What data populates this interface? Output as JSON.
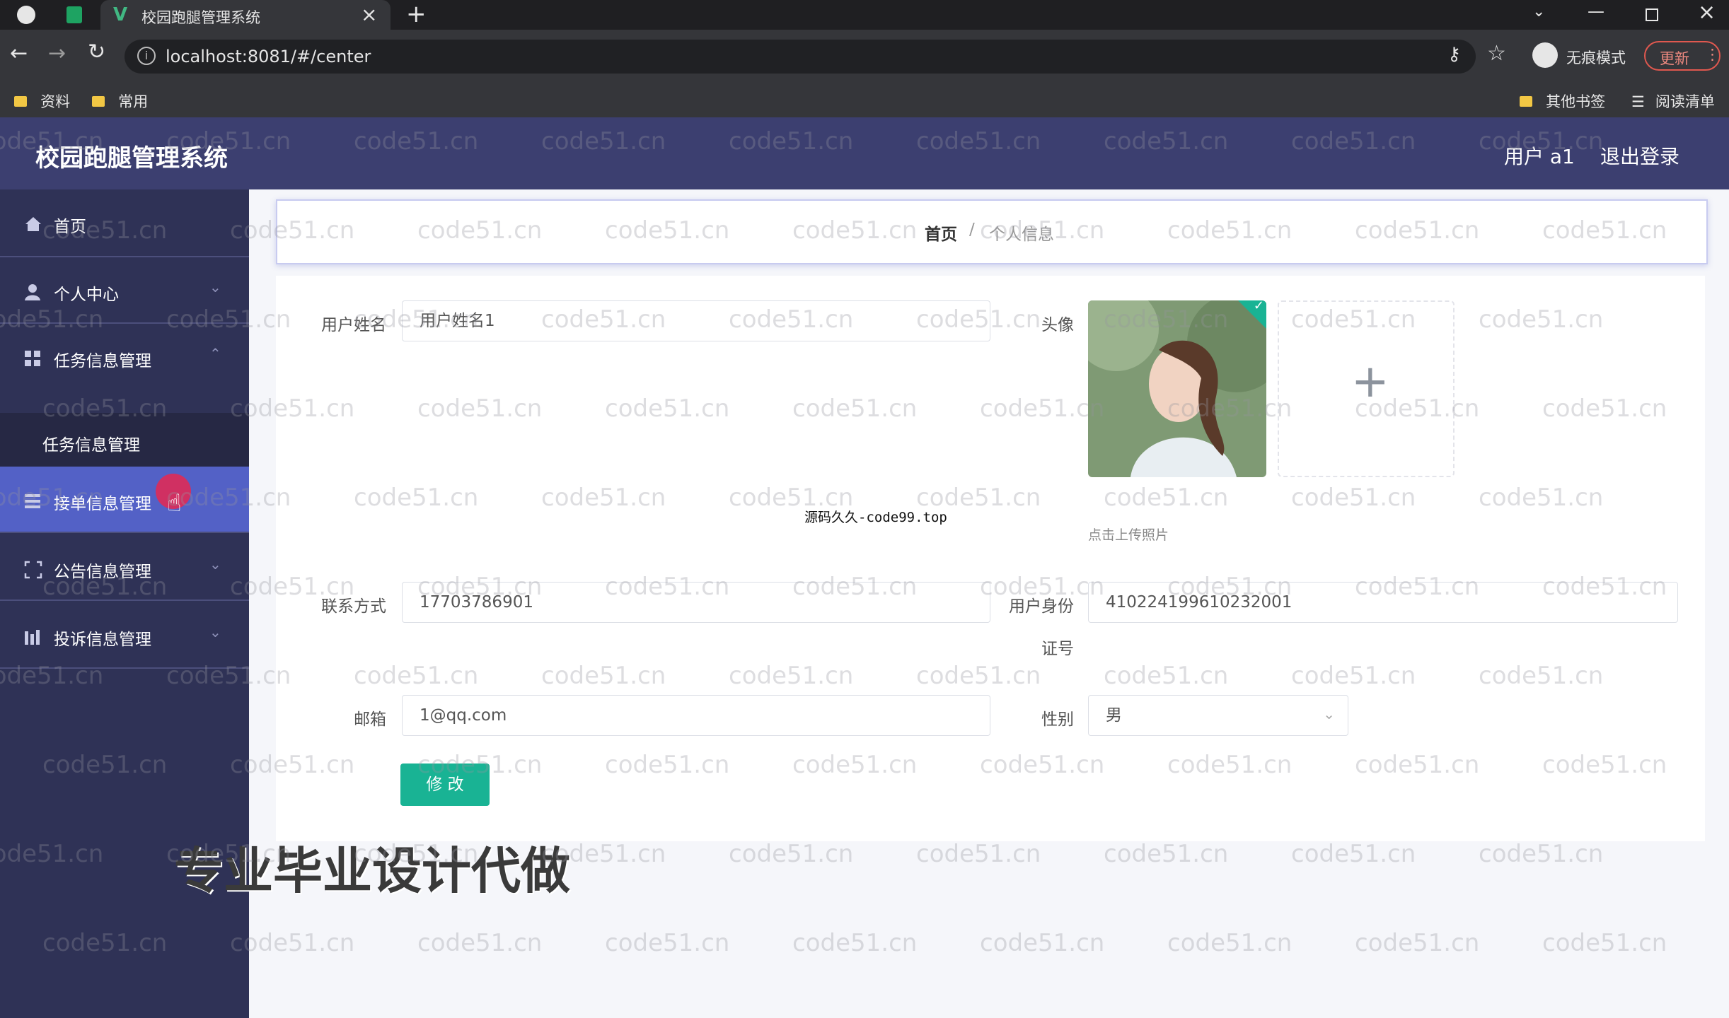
{
  "browser": {
    "tab_title": "校园跑腿管理系统",
    "tab_close": "×",
    "new_tab": "+",
    "url": "localhost:8081/#/center",
    "incognito_label": "无痕模式",
    "update_label": "更新",
    "bookmarks": [
      "资料",
      "常用"
    ],
    "other_bookmarks": "其他书签",
    "reading_list": "阅读清单",
    "window_controls": [
      "minimize-icon",
      "restore-icon",
      "close-icon"
    ]
  },
  "header": {
    "title": "校园跑腿管理系统",
    "user": "用户 a1",
    "logout": "退出登录"
  },
  "sidebar": {
    "items": [
      {
        "label": "首页",
        "icon": "home-icon"
      },
      {
        "label": "个人中心",
        "icon": "user-icon"
      },
      {
        "label": "任务信息管理",
        "icon": "grid-icon"
      },
      {
        "label": "任务信息管理",
        "sub": true
      },
      {
        "label": "接单信息管理",
        "icon": "list-icon"
      },
      {
        "label": "公告信息管理",
        "icon": "bracket-icon"
      },
      {
        "label": "投诉信息管理",
        "icon": "chart-icon"
      }
    ]
  },
  "breadcrumb": {
    "home": "首页",
    "sep": "/",
    "current": "个人信息"
  },
  "form": {
    "username_label": "用户姓名",
    "username_value": "用户姓名1",
    "avatar_label": "头像",
    "upload_hint": "点击上传照片",
    "phone_label": "联系方式",
    "phone_value": "17703786901",
    "idcard_label_1": "用户身份",
    "idcard_label_2": "证号",
    "idcard_value": "410224199610232001",
    "email_label": "邮箱",
    "email_value": "1@qq.com",
    "gender_label": "性别",
    "gender_value": "男",
    "submit": "修 改"
  },
  "overlay": {
    "caption": "源码久久-code99.top",
    "promo": "专业毕业设计代做",
    "watermark": "code51.cn"
  },
  "colors": {
    "header_bg": "#3c3f70",
    "sidebar_bg": "#2f3256",
    "active_item": "#5361c6",
    "submit_button": "#19b394"
  }
}
